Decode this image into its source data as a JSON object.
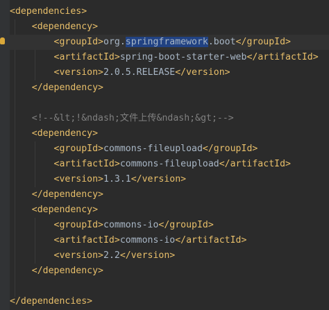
{
  "code": {
    "l1": {
      "open": "<dependencies>"
    },
    "l2": {
      "open": "<dependency>"
    },
    "l3": {
      "open": "<groupId>",
      "pre": "org.",
      "selected": "springframework",
      "post": ".boot",
      "close": "</groupId>"
    },
    "l4": {
      "open": "<artifactId>",
      "value": "spring-boot-starter-web",
      "close": "</artifactId>"
    },
    "l5": {
      "open": "<version>",
      "value": "2.0.5.RELEASE",
      "close": "</version>"
    },
    "l6": {
      "close": "</dependency>"
    },
    "l8": {
      "comment": "<!--&lt;!&ndash;文件上传&ndash;&gt;-->"
    },
    "l9": {
      "open": "<dependency>"
    },
    "l10": {
      "open": "<groupId>",
      "value": "commons-fileupload",
      "close": "</groupId>"
    },
    "l11": {
      "open": "<artifactId>",
      "value": "commons-fileupload",
      "close": "</artifactId>"
    },
    "l12": {
      "open": "<version>",
      "value": "1.3.1",
      "close": "</version>"
    },
    "l13": {
      "close": "</dependency>"
    },
    "l14": {
      "open": "<dependency>"
    },
    "l15": {
      "open": "<groupId>",
      "value": "commons-io",
      "close": "</groupId>"
    },
    "l16": {
      "open": "<artifactId>",
      "value": "commons-io",
      "close": "</artifactId>"
    },
    "l17": {
      "open": "<version>",
      "value": "2.2",
      "close": "</version>"
    },
    "l18": {
      "close": "</dependency>"
    },
    "l20": {
      "close": "</dependencies>"
    }
  },
  "colors": {
    "background": "#2b2b2b",
    "tag": "#e8bf6a",
    "text": "#a9b7c6",
    "comment": "#808080",
    "selection": "#214283"
  },
  "icons": {
    "gutter_marker": "lightbulb-icon"
  }
}
